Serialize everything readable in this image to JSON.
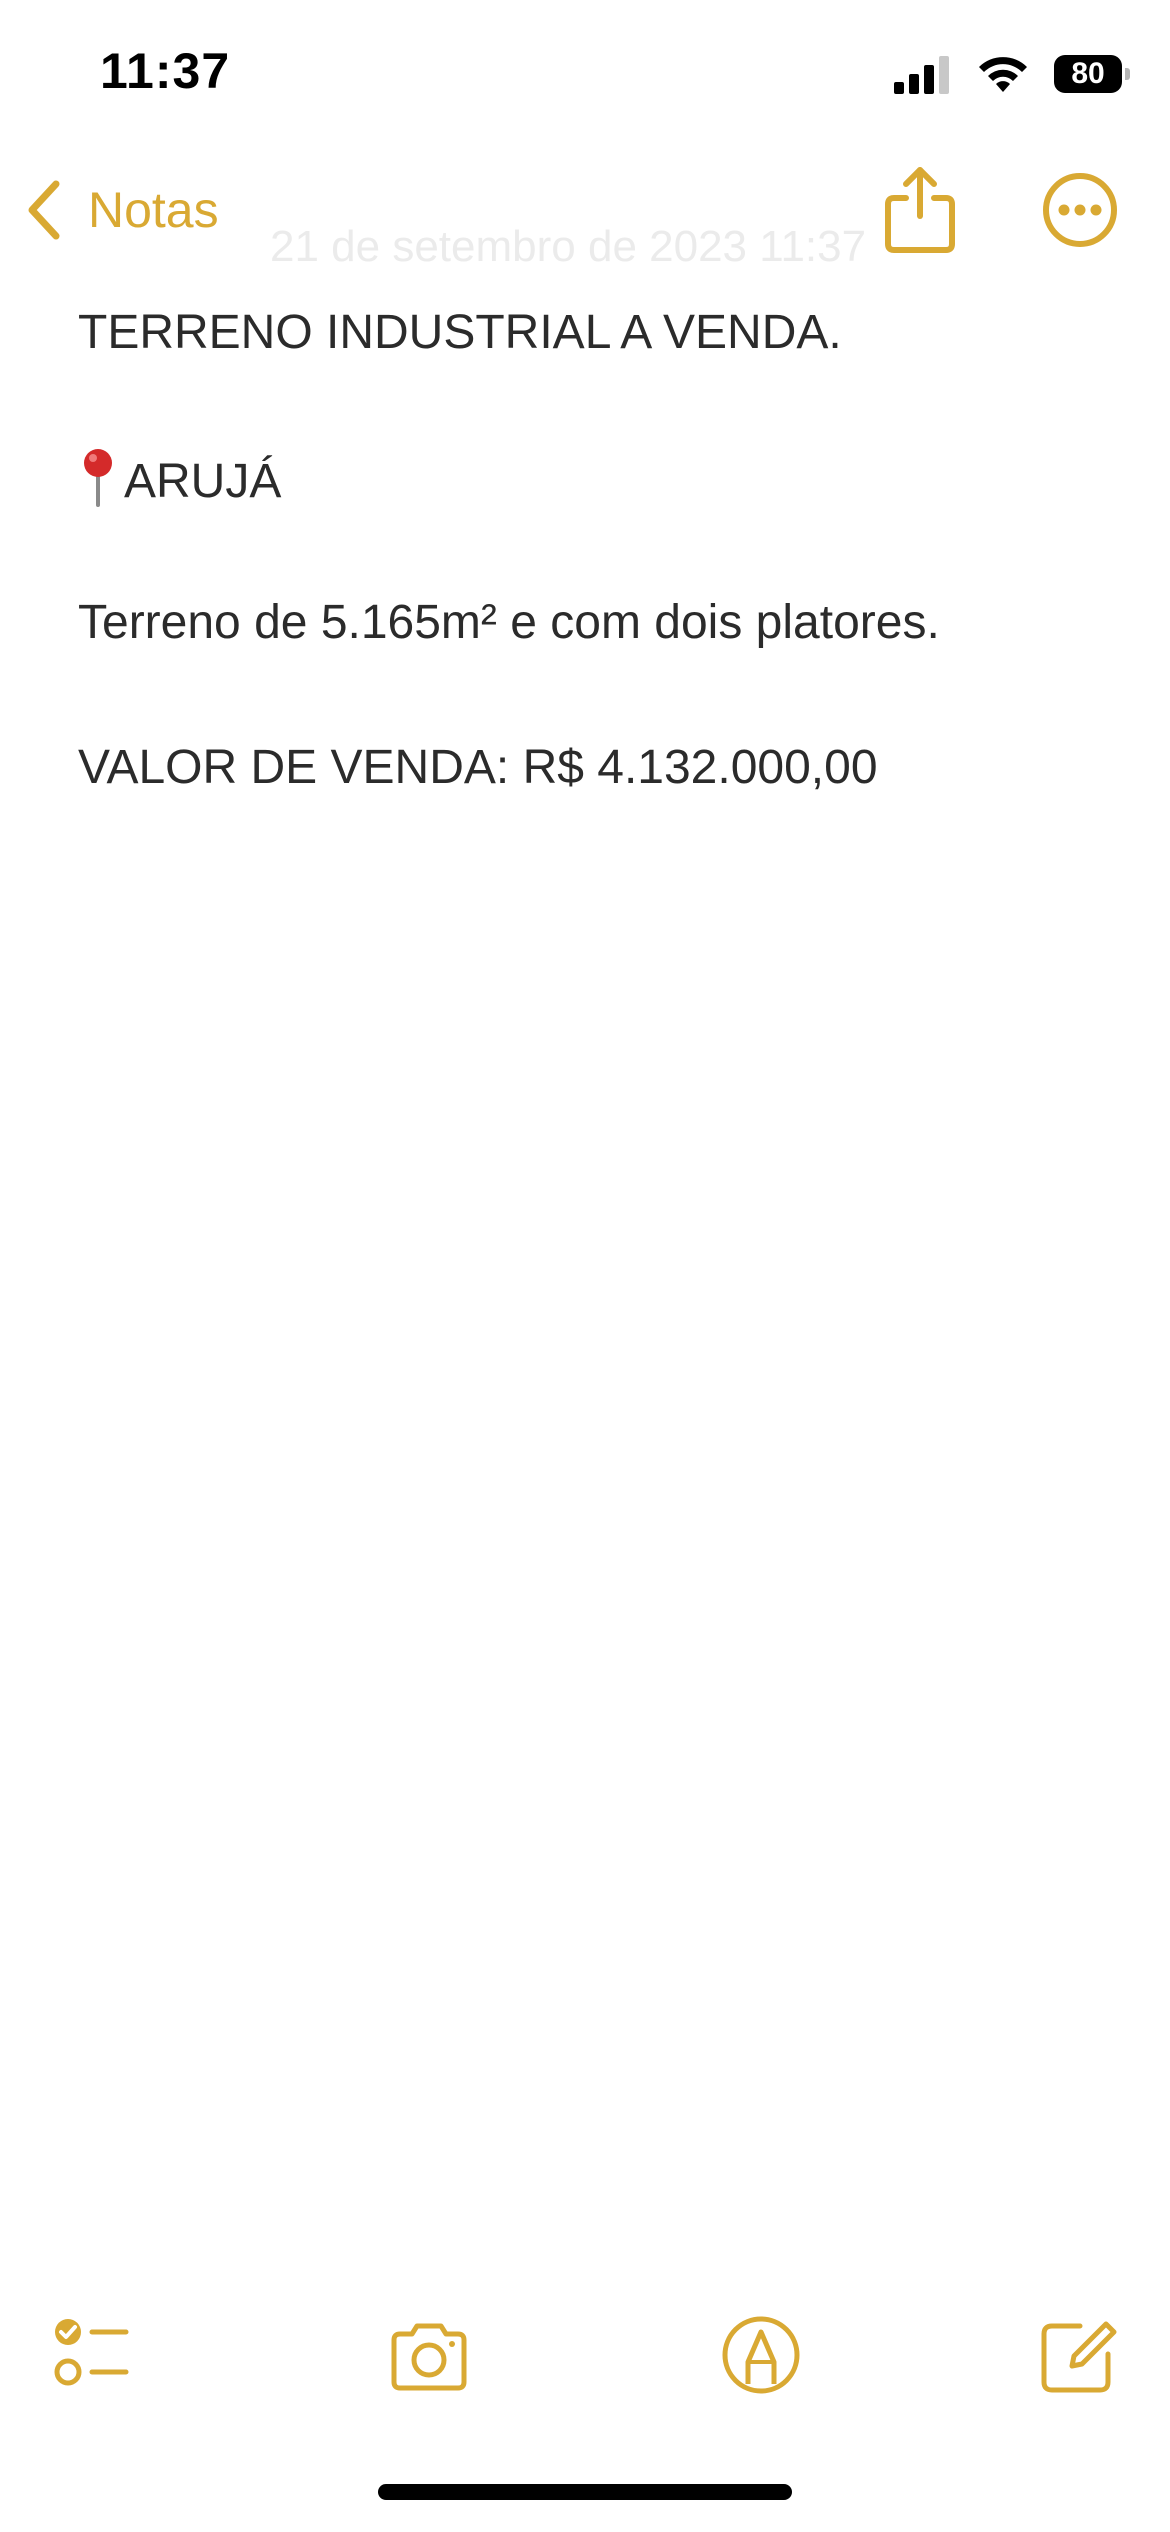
{
  "status_bar": {
    "time": "11:37",
    "battery": "80",
    "icons": [
      "cellular-signal-icon",
      "wifi-icon",
      "battery-icon"
    ]
  },
  "nav": {
    "back_label": "Notas",
    "date_faded": "21 de setembro de 2023 11:37",
    "share_icon": "share-icon",
    "more_icon": "more-options-icon"
  },
  "note": {
    "line1": "TERRENO INDUSTRIAL A VENDA.",
    "line2": "ARUJÁ",
    "line3": "Terreno de 5.165m² e com dois platores.",
    "line4": "VALOR DE VENDA: R$ 4.132.000,00"
  },
  "toolbar": {
    "items": [
      "checklist-icon",
      "camera-icon",
      "markup-icon",
      "compose-icon"
    ]
  },
  "colors": {
    "accent": "#d9a933",
    "text": "#2b2b2b",
    "background": "#ffffff"
  }
}
